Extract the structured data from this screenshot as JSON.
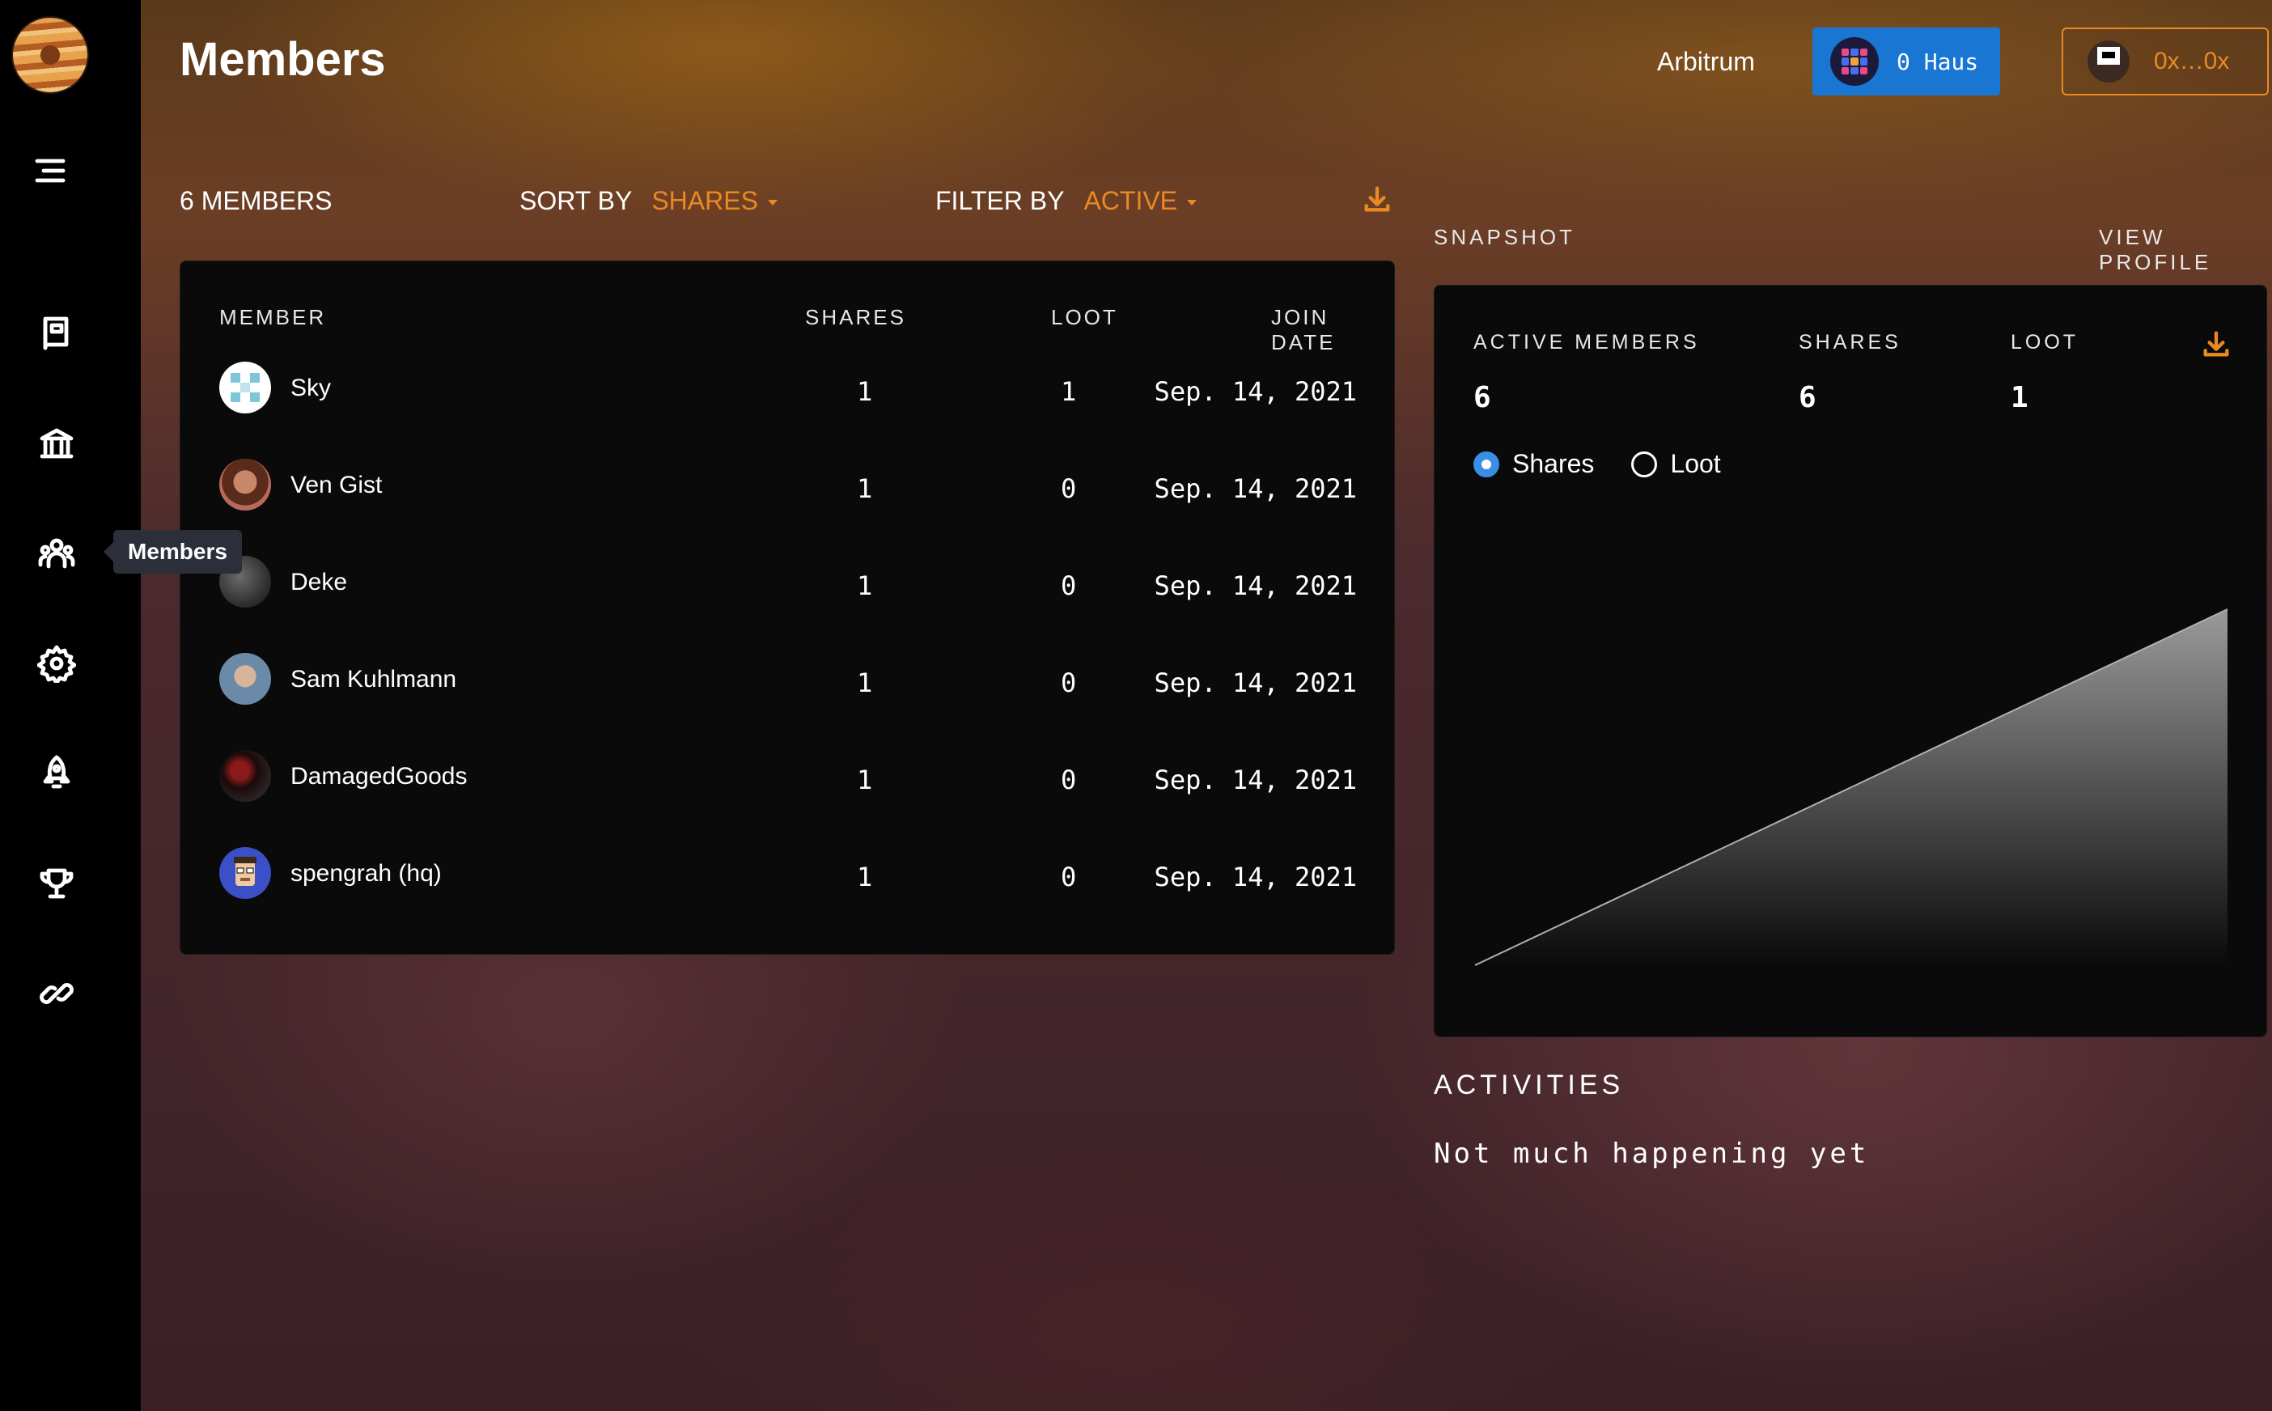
{
  "header": {
    "title": "Members",
    "network": "Arbitrum",
    "haus_balance": "0 Haus",
    "wallet_address": "0x…0x"
  },
  "sidebar": {
    "items": [
      {
        "icon": "menu-icon"
      },
      {
        "icon": "book-icon"
      },
      {
        "icon": "bank-icon"
      },
      {
        "icon": "members-icon"
      },
      {
        "icon": "gear-icon"
      },
      {
        "icon": "rocket-icon"
      },
      {
        "icon": "trophy-icon"
      },
      {
        "icon": "link-icon"
      }
    ],
    "tooltip": "Members"
  },
  "toolbar": {
    "members_count": "6 MEMBERS",
    "sort_label": "SORT BY",
    "sort_value": "SHARES",
    "filter_label": "FILTER BY",
    "filter_value": "ACTIVE"
  },
  "table": {
    "columns": [
      "MEMBER",
      "SHARES",
      "LOOT",
      "JOIN DATE"
    ],
    "rows": [
      {
        "name": "Sky",
        "shares": "1",
        "loot": "1",
        "join_date": "Sep. 14, 2021"
      },
      {
        "name": "Ven Gist",
        "shares": "1",
        "loot": "0",
        "join_date": "Sep. 14, 2021"
      },
      {
        "name": "Deke",
        "shares": "1",
        "loot": "0",
        "join_date": "Sep. 14, 2021"
      },
      {
        "name": "Sam Kuhlmann",
        "shares": "1",
        "loot": "0",
        "join_date": "Sep. 14, 2021"
      },
      {
        "name": "DamagedGoods",
        "shares": "1",
        "loot": "0",
        "join_date": "Sep. 14, 2021"
      },
      {
        "name": "spengrah (hq)",
        "shares": "1",
        "loot": "0",
        "join_date": "Sep. 14, 2021"
      }
    ]
  },
  "snapshot": {
    "label": "SNAPSHOT",
    "view_profile": "VIEW PROFILE",
    "stats": {
      "active_members_label": "ACTIVE MEMBERS",
      "active_members_value": "6",
      "shares_label": "SHARES",
      "shares_value": "6",
      "loot_label": "LOOT",
      "loot_value": "1"
    },
    "radio_shares": "Shares",
    "radio_loot": "Loot",
    "selected": "Shares"
  },
  "chart_data": {
    "type": "area",
    "x": [
      0,
      1
    ],
    "values": [
      0,
      6
    ],
    "series": [
      {
        "values": [
          0,
          6
        ]
      }
    ]
  },
  "activities": {
    "title": "ACTIVITIES",
    "empty_text": "Not much happening yet"
  },
  "colors": {
    "accent": "#ea8923",
    "button_blue": "#1976d2",
    "radio_blue": "#3a8ee6",
    "panel": "#0a0a0b"
  }
}
